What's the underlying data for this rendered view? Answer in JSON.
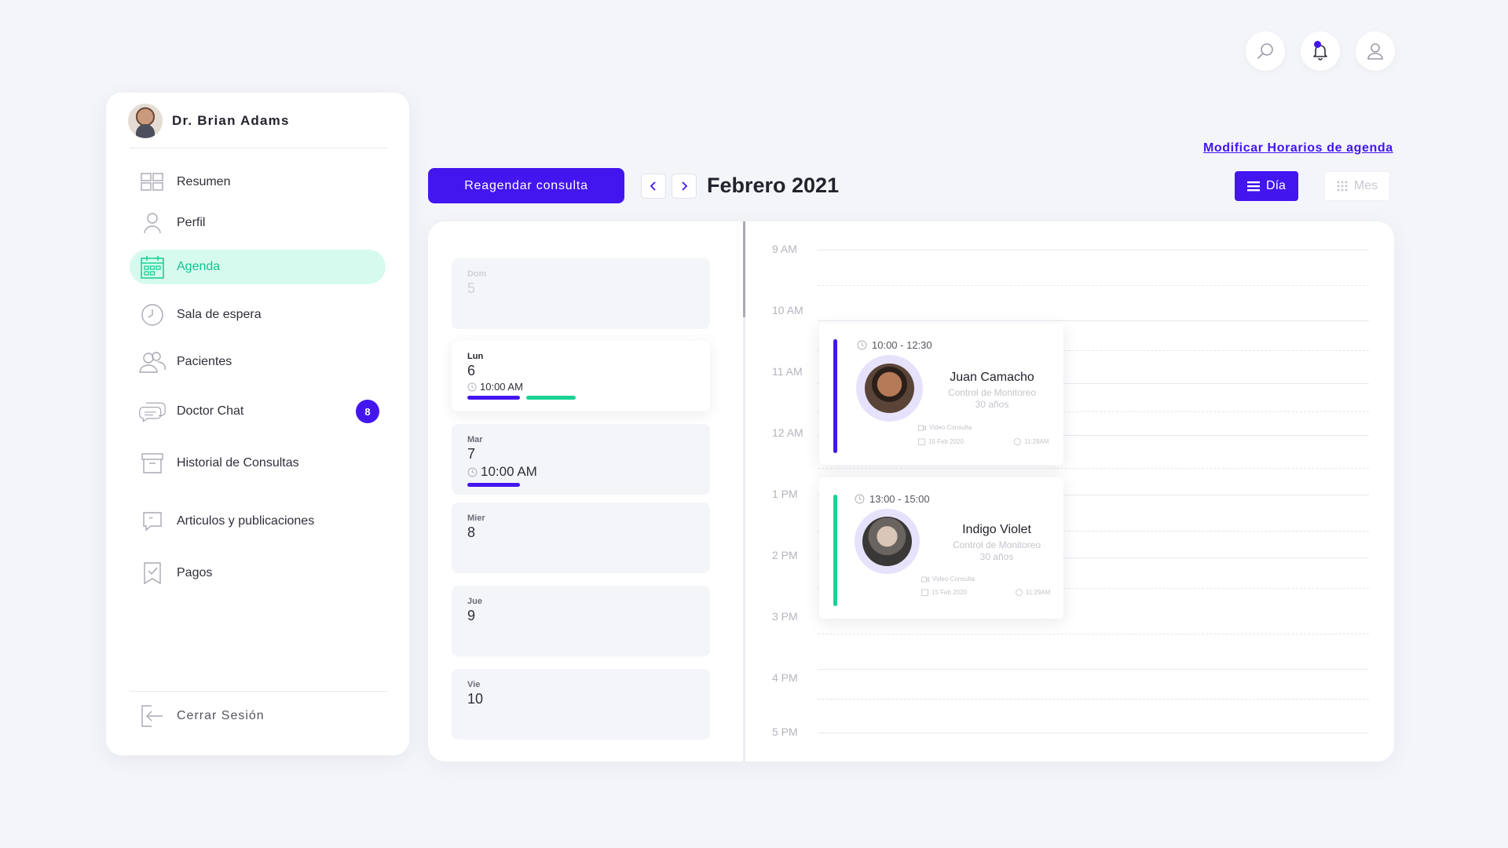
{
  "header_icons": [
    {
      "name": "search-icon"
    },
    {
      "name": "bell-icon"
    },
    {
      "name": "user-icon"
    }
  ],
  "sidebar": {
    "doctor_name": "Dr. Brian Adams",
    "items": [
      {
        "label": "Resumen",
        "icon": "grid-icon"
      },
      {
        "label": "Perfil",
        "icon": "person-icon"
      },
      {
        "label": "Agenda",
        "icon": "calendar-icon",
        "active": true
      },
      {
        "label": "Sala de espera",
        "icon": "clock-icon"
      },
      {
        "label": "Pacientes",
        "icon": "users-icon"
      },
      {
        "label": "Doctor Chat",
        "icon": "chat-icon",
        "badge": "8"
      },
      {
        "label": "Historial de Consultas",
        "icon": "archive-icon"
      },
      {
        "label": "Articulos y publicaciones",
        "icon": "quote-icon"
      },
      {
        "label": "Pagos",
        "icon": "receipt-icon"
      }
    ],
    "logout_label": "Cerrar Sesión"
  },
  "toolbar": {
    "reschedule_label": "Reagendar consulta",
    "month_title": "Febrero 2021",
    "modify_link": "Modificar Horarios de agenda",
    "view_day": "Día",
    "view_month": "Mes"
  },
  "days": [
    {
      "abbr": "Dom",
      "num": "5",
      "muted": true
    },
    {
      "abbr": "Lun",
      "num": "6",
      "time": "10:00 AM",
      "selected": true
    },
    {
      "abbr": "Mar",
      "num": "7",
      "time": "10:00 AM"
    },
    {
      "abbr": "Mier",
      "num": "8"
    },
    {
      "abbr": "Jue",
      "num": "9"
    },
    {
      "abbr": "Vie",
      "num": "10"
    }
  ],
  "time_labels": [
    "9 AM",
    "10 AM",
    "11 AM",
    "12 AM",
    "1 PM",
    "2 PM",
    "3 PM",
    "4 PM",
    "5 PM"
  ],
  "appointments": [
    {
      "time": "10:00 - 12:30",
      "name": "Juan Camacho",
      "type": "Control de Monitoreo",
      "age": "30 años",
      "mode": "Video Consulta",
      "date": "15 Feb 2020",
      "clock": "11:29AM",
      "accent": "#4316f0"
    },
    {
      "time": "13:00 - 15:00",
      "name": "Indigo Violet",
      "type": "Control de Monitoreo",
      "age": "30 años",
      "mode": "Video Consulta",
      "date": "15 Feb 2020",
      "clock": "11:29AM",
      "accent": "#19d394"
    }
  ],
  "colors": {
    "primary": "#4316f0",
    "accent_green": "#19d394",
    "active_bg": "#d7faef"
  }
}
